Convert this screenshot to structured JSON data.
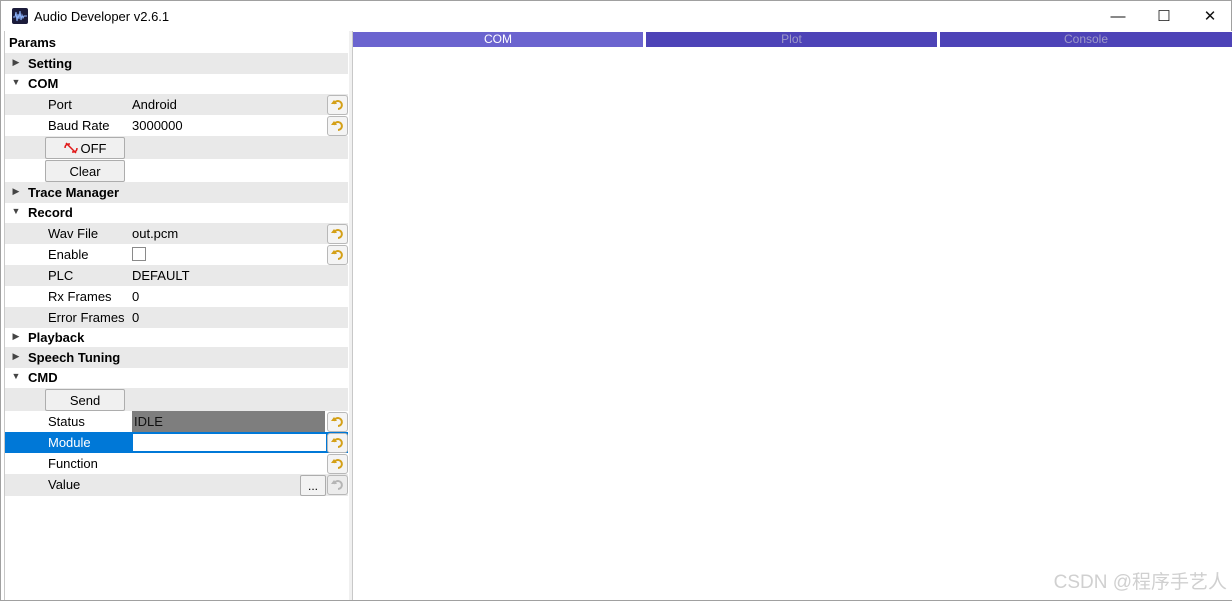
{
  "window": {
    "title": "Audio Developer v2.6.1",
    "minimize_glyph": "—",
    "maximize_glyph": "☐",
    "close_glyph": "✕"
  },
  "tabs": [
    {
      "label": "COM",
      "active": true
    },
    {
      "label": "Plot",
      "active": false
    },
    {
      "label": "Console",
      "active": false
    }
  ],
  "params": {
    "header": "Params",
    "groups": {
      "setting": "Setting",
      "com": "COM",
      "trace_manager": "Trace Manager",
      "record": "Record",
      "playback": "Playback",
      "speech_tuning": "Speech Tuning",
      "cmd": "CMD"
    },
    "com": {
      "port_label": "Port",
      "port_value": "Android",
      "baud_label": "Baud Rate",
      "baud_value": "3000000",
      "toggle_label": "OFF",
      "clear_label": "Clear"
    },
    "record": {
      "wav_label": "Wav File",
      "wav_value": "out.pcm",
      "enable_label": "Enable",
      "enable_checked": false,
      "plc_label": "PLC",
      "plc_value": "DEFAULT",
      "rx_label": "Rx Frames",
      "rx_value": "0",
      "err_label": "Error Frames",
      "err_value": "0"
    },
    "cmd": {
      "send_label": "Send",
      "status_label": "Status",
      "status_value": "IDLE",
      "module_label": "Module",
      "module_value": "",
      "function_label": "Function",
      "value_label": "Value",
      "browse_label": "..."
    }
  },
  "watermark": "CSDN @程序手艺人",
  "colors": {
    "tab_active": "#6b64cf",
    "tab_inactive": "#4d43b7",
    "selection": "#0078d7",
    "status_bg": "#7e7e7e"
  }
}
